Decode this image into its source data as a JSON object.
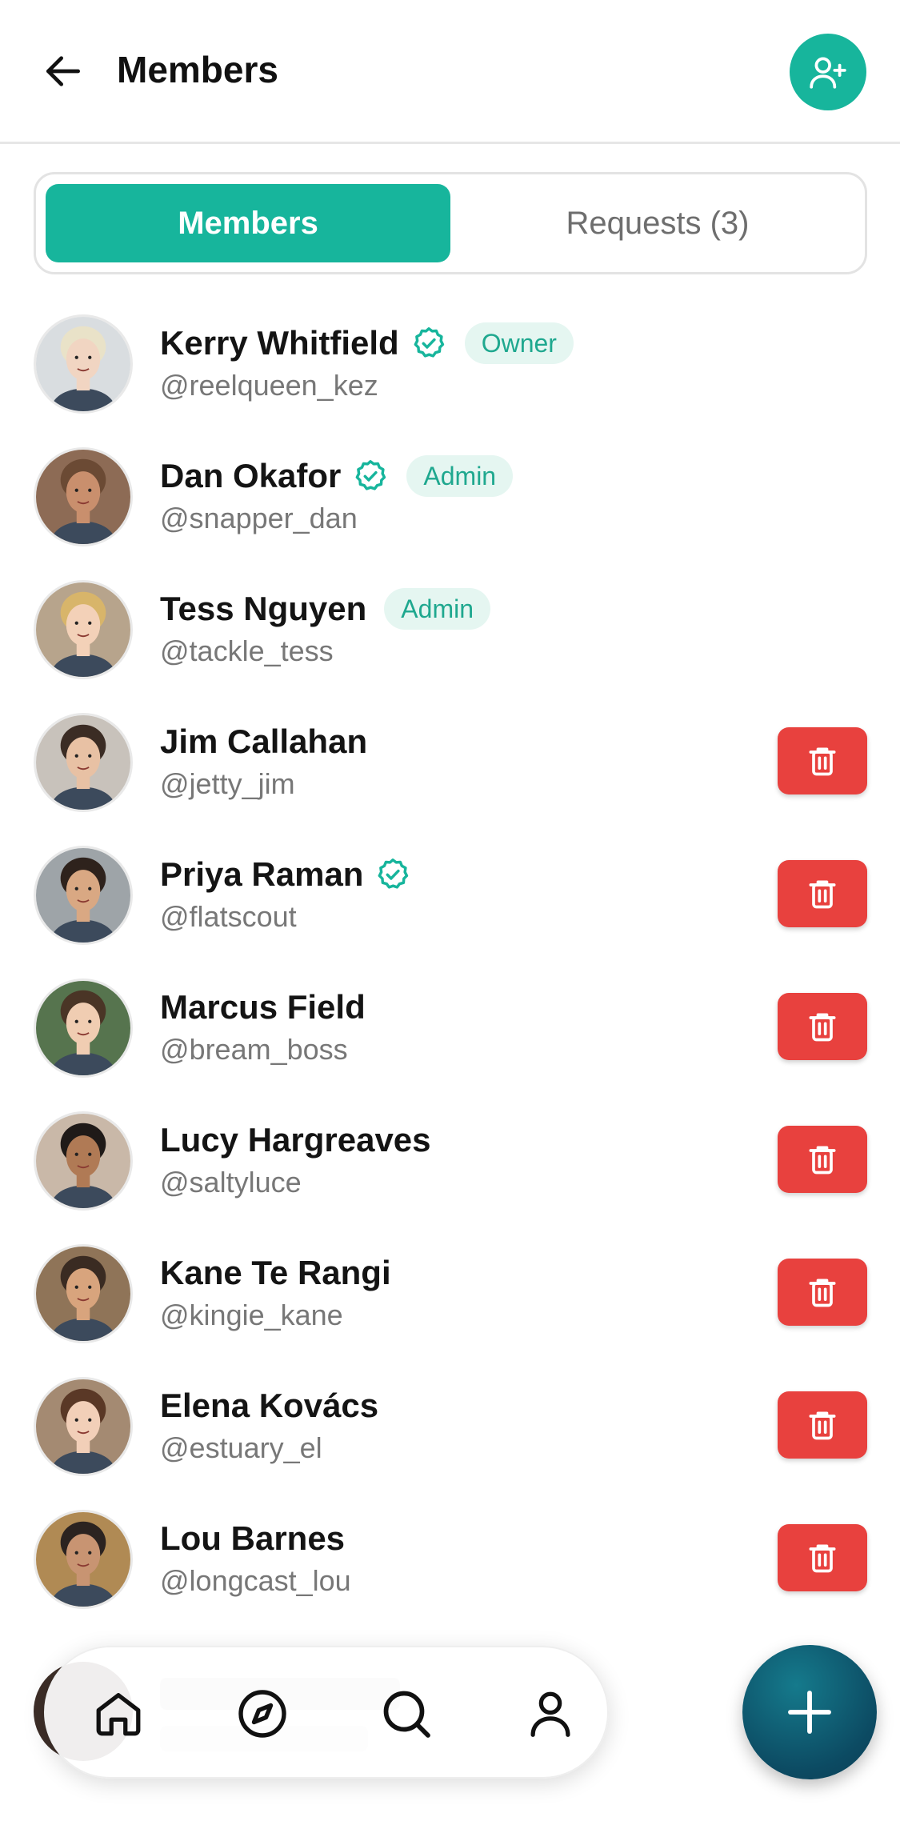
{
  "header": {
    "title": "Members"
  },
  "tabs": {
    "members": "Members",
    "requests": "Requests (3)"
  },
  "members": [
    {
      "name": "Kerry Whitfield",
      "handle": "@reelqueen_kez",
      "verified": true,
      "role": "Owner",
      "removable": false
    },
    {
      "name": "Dan Okafor",
      "handle": "@snapper_dan",
      "verified": true,
      "role": "Admin",
      "removable": false
    },
    {
      "name": "Tess Nguyen",
      "handle": "@tackle_tess",
      "verified": false,
      "role": "Admin",
      "removable": false
    },
    {
      "name": "Jim Callahan",
      "handle": "@jetty_jim",
      "verified": false,
      "role": "",
      "removable": true
    },
    {
      "name": "Priya Raman",
      "handle": "@flatscout",
      "verified": true,
      "role": "",
      "removable": true
    },
    {
      "name": "Marcus Field",
      "handle": "@bream_boss",
      "verified": false,
      "role": "",
      "removable": true
    },
    {
      "name": "Lucy Hargreaves",
      "handle": "@saltyluce",
      "verified": false,
      "role": "",
      "removable": true
    },
    {
      "name": "Kane Te Rangi",
      "handle": "@kingie_kane",
      "verified": false,
      "role": "",
      "removable": true
    },
    {
      "name": "Elena Kovács",
      "handle": "@estuary_el",
      "verified": false,
      "role": "",
      "removable": true
    },
    {
      "name": "Lou Barnes",
      "handle": "@longcast_lou",
      "verified": false,
      "role": "",
      "removable": true
    }
  ],
  "bottom_nav": [
    "home-icon",
    "compass-icon",
    "search-icon",
    "profile-icon"
  ],
  "colors": {
    "accent": "#17b59c",
    "danger": "#e8413e",
    "fab": "#0c4a62"
  }
}
